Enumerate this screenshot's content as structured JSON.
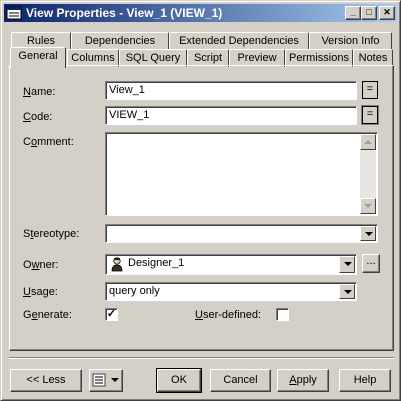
{
  "window": {
    "title": "View Properties - View_1 (VIEW_1)",
    "minimize_glyph": "_",
    "maximize_glyph": "□",
    "close_glyph": "✕"
  },
  "tabs": {
    "row_back": [
      "Rules",
      "Dependencies",
      "Extended Dependencies",
      "Version Info"
    ],
    "row_front": [
      "General",
      "Columns",
      "SQL Query",
      "Script",
      "Preview",
      "Permissions",
      "Notes"
    ],
    "active": "General"
  },
  "form": {
    "name": {
      "label_key": "N",
      "label_rest": "ame:",
      "value": "View_1",
      "eq_button": "="
    },
    "code": {
      "label_key": "C",
      "label_rest": "ode:",
      "value": "VIEW_1",
      "eq_button": "="
    },
    "comment": {
      "label_first": "C",
      "label_key": "o",
      "label_rest": "mment:",
      "value": ""
    },
    "stereotype": {
      "label_first": "S",
      "label_key": "t",
      "label_rest": "ereotype:",
      "value": ""
    },
    "owner": {
      "label_first": "O",
      "label_key": "w",
      "label_rest": "ner:",
      "value": "Designer_1",
      "icon": "user-icon",
      "ellipsis": "..."
    },
    "usage": {
      "label_key": "U",
      "label_rest": "sage:",
      "value": "query only"
    },
    "generate": {
      "label_first": "G",
      "label_key": "e",
      "label_rest": "nerate:",
      "checked": true,
      "check_glyph": "✓"
    },
    "user_defined": {
      "label_key": "U",
      "label_rest": "ser-defined:",
      "checked": false
    }
  },
  "buttons": {
    "less": "<< Less",
    "ok": "OK",
    "cancel": "Cancel",
    "apply_key": "A",
    "apply_rest": "pply",
    "help": "Help"
  },
  "colors": {
    "title_bar_start": "#0a246a",
    "title_bar_end": "#a6caf0",
    "face": "#d4d0c8"
  }
}
